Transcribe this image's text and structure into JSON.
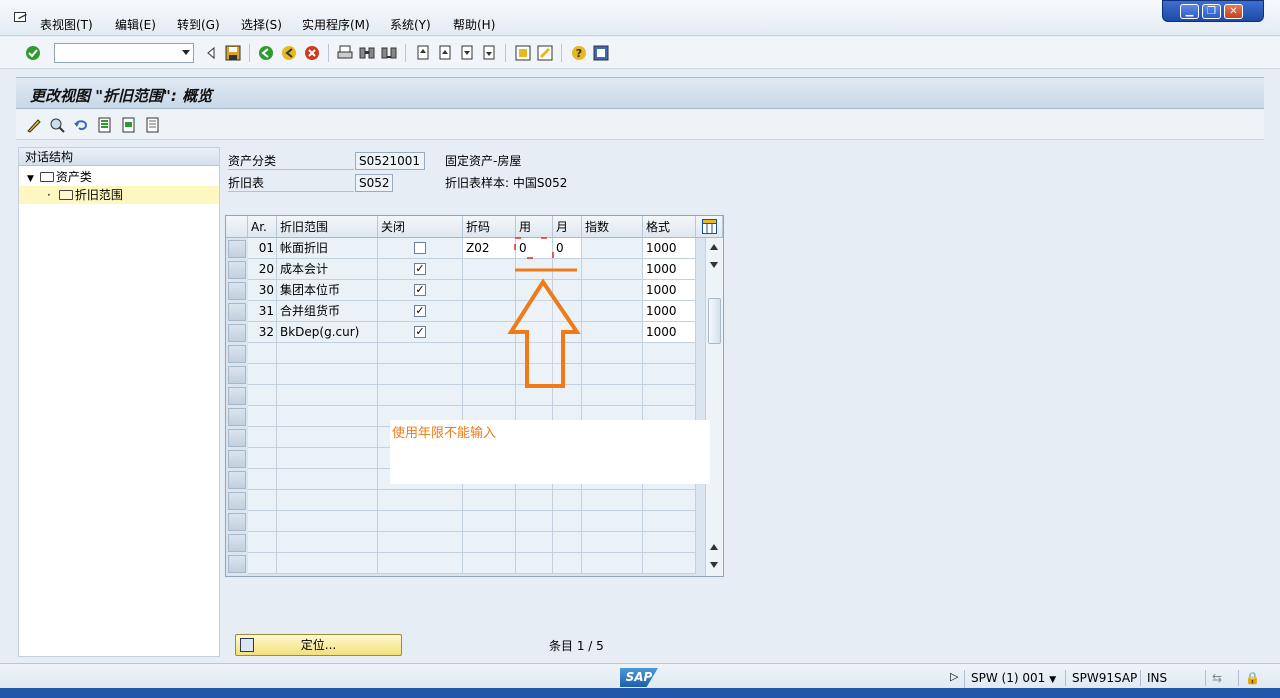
{
  "menubar": {
    "items": [
      "表视图(T)",
      "编辑(E)",
      "转到(G)",
      "选择(S)",
      "实用程序(M)",
      "系统(Y)",
      "帮助(H)"
    ]
  },
  "window_buttons": {
    "minimize": "▁",
    "restore": "❐",
    "close": "✕"
  },
  "page_title": "更改视图 \"折旧范围\": 概览",
  "tree": {
    "header": "对话结构",
    "nodes": [
      "资产类",
      "折旧范围"
    ]
  },
  "fields": {
    "asset_class_label": "资产分类",
    "asset_class_value": "S0521001",
    "asset_class_desc": "固定资产-房屋",
    "dep_table_label": "折旧表",
    "dep_table_value": "S052",
    "dep_table_desc": "折旧表样本: 中国S052"
  },
  "table": {
    "columns": [
      "Ar.",
      "折旧范围",
      "关闭",
      "折码",
      "用",
      "月",
      "指数",
      "格式"
    ],
    "rows": [
      {
        "ar": "01",
        "name": "帐面折旧",
        "closed": false,
        "key": "Z02",
        "years": "0",
        "months": "0",
        "index": "",
        "layout": "1000"
      },
      {
        "ar": "20",
        "name": "成本会计",
        "closed": true,
        "key": "",
        "years": "",
        "months": "",
        "index": "",
        "layout": "1000"
      },
      {
        "ar": "30",
        "name": "集团本位币",
        "closed": true,
        "key": "",
        "years": "",
        "months": "",
        "index": "",
        "layout": "1000"
      },
      {
        "ar": "31",
        "name": "合并组货币",
        "closed": true,
        "key": "",
        "years": "",
        "months": "",
        "index": "",
        "layout": "1000"
      },
      {
        "ar": "32",
        "name": "BkDep(g.cur)",
        "closed": true,
        "key": "",
        "years": "",
        "months": "",
        "index": "",
        "layout": "1000"
      }
    ],
    "empty_rows": 11
  },
  "annotation_text": "使用年限不能输入",
  "position_button": "定位...",
  "entries": "条目 1 / 5",
  "status": {
    "system": "SPW (1) 001",
    "server": "SPW91SAP",
    "mode": "INS"
  },
  "colors": {
    "annotation": "#f07a18",
    "title_bg": "#c8d8e8",
    "selected_node": "#fef7c0"
  }
}
